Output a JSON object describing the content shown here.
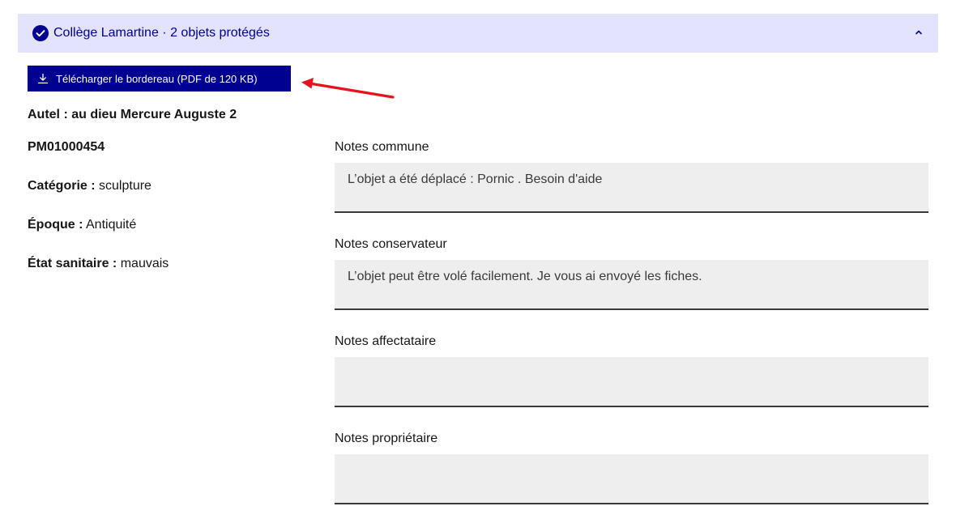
{
  "accordion": {
    "title": "Collège Lamartine · 2 objets protégés",
    "icons": {
      "status": "check-circle-icon",
      "toggle": "chevron-up-icon"
    },
    "colors": {
      "header_bg": "#e3e3fd",
      "accent": "#000091"
    }
  },
  "download": {
    "label": "Télécharger le bordereau (PDF de 120 KB)",
    "icon": "download-icon"
  },
  "annotation": {
    "color": "#e8121c"
  },
  "object": {
    "title": "Autel : au dieu Mercure Auguste 2",
    "reference": "PM01000454",
    "category_label": "Catégorie :",
    "category_value": "sculpture",
    "epoque_label": "Époque :",
    "epoque_value": "Antiquité",
    "etat_label": "État sanitaire :",
    "etat_value": "mauvais"
  },
  "notes": [
    {
      "label": "Notes commune",
      "value": "L’objet a été déplacé : Pornic . Besoin d'aide"
    },
    {
      "label": "Notes conservateur",
      "value": "L’objet peut être volé facilement. Je vous ai envoyé les fiches."
    },
    {
      "label": "Notes affectataire",
      "value": ""
    },
    {
      "label": "Notes propriétaire",
      "value": ""
    }
  ]
}
